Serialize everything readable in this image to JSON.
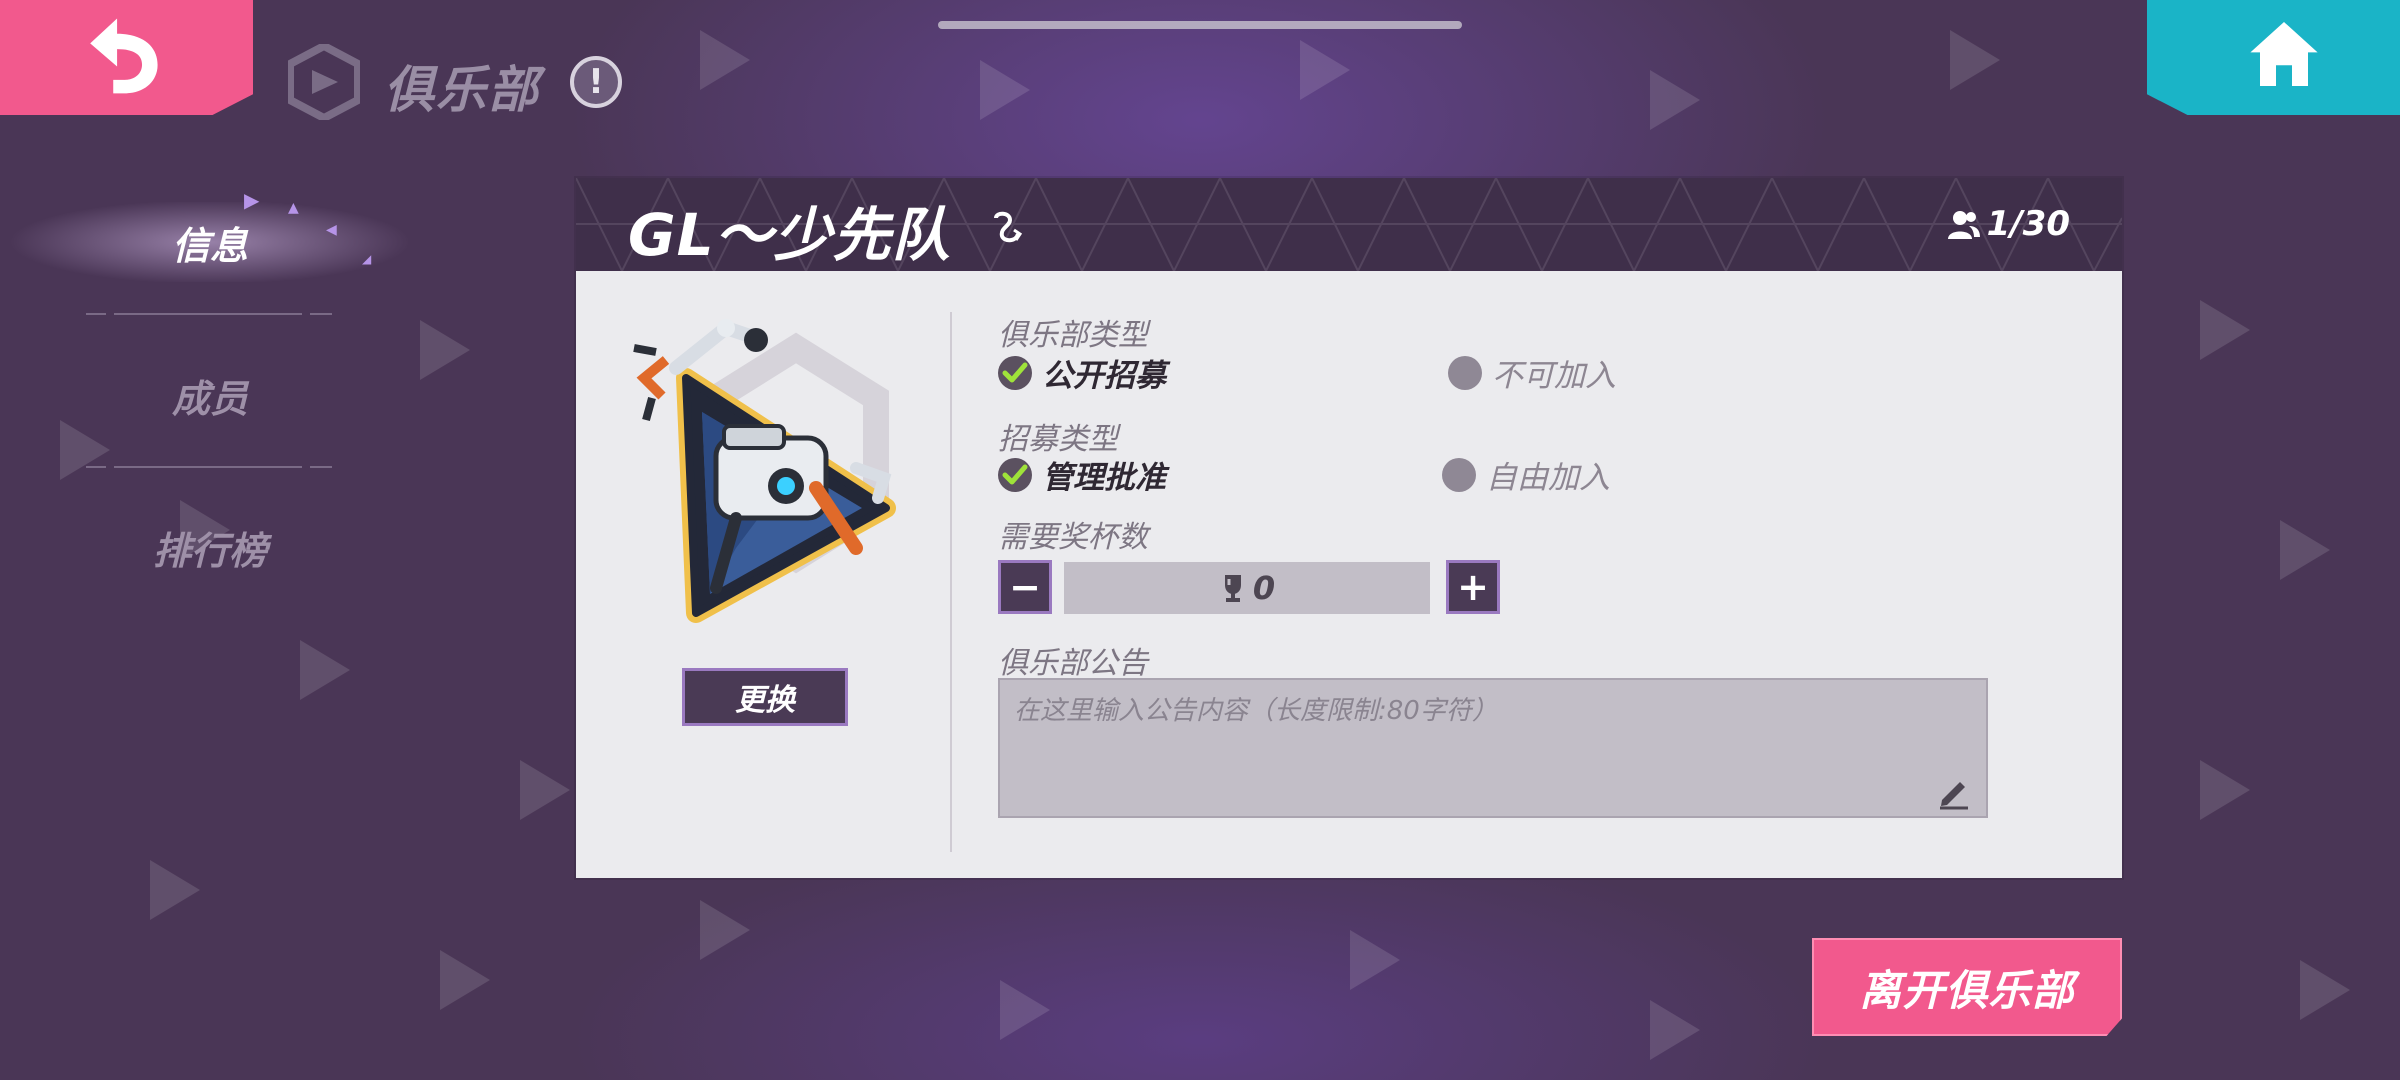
{
  "header": {
    "title": "俱乐部",
    "back_icon": "back-arrow-icon",
    "home_icon": "home-icon",
    "info_icon": "info-icon",
    "info_symbol": "!"
  },
  "sidebar": {
    "items": [
      {
        "label": "信息",
        "active": true
      },
      {
        "label": "成员",
        "active": false
      },
      {
        "label": "排行榜",
        "active": false
      }
    ]
  },
  "club": {
    "name": "GL～少先队",
    "member_count": "1/30",
    "change_label": "更换"
  },
  "form": {
    "club_type_label": "俱乐部类型",
    "club_type_options": [
      {
        "label": "公开招募",
        "selected": true
      },
      {
        "label": "不可加入",
        "selected": false
      }
    ],
    "recruit_type_label": "招募类型",
    "recruit_type_options": [
      {
        "label": "管理批准",
        "selected": true
      },
      {
        "label": "自由加入",
        "selected": false
      }
    ],
    "trophy_label": "需要奖杯数",
    "trophy_value": "0",
    "minus_label": "−",
    "plus_label": "+",
    "notice_label": "俱乐部公告",
    "notice_placeholder": "在这里输入公告内容（长度限制:80字符）"
  },
  "actions": {
    "leave_label": "离开俱乐部"
  },
  "colors": {
    "background": "#4a3656",
    "accent_pink": "#f2598d",
    "accent_teal": "#1ab4c7",
    "panel": "#ebebee",
    "panel_header": "#3f2f4a"
  }
}
